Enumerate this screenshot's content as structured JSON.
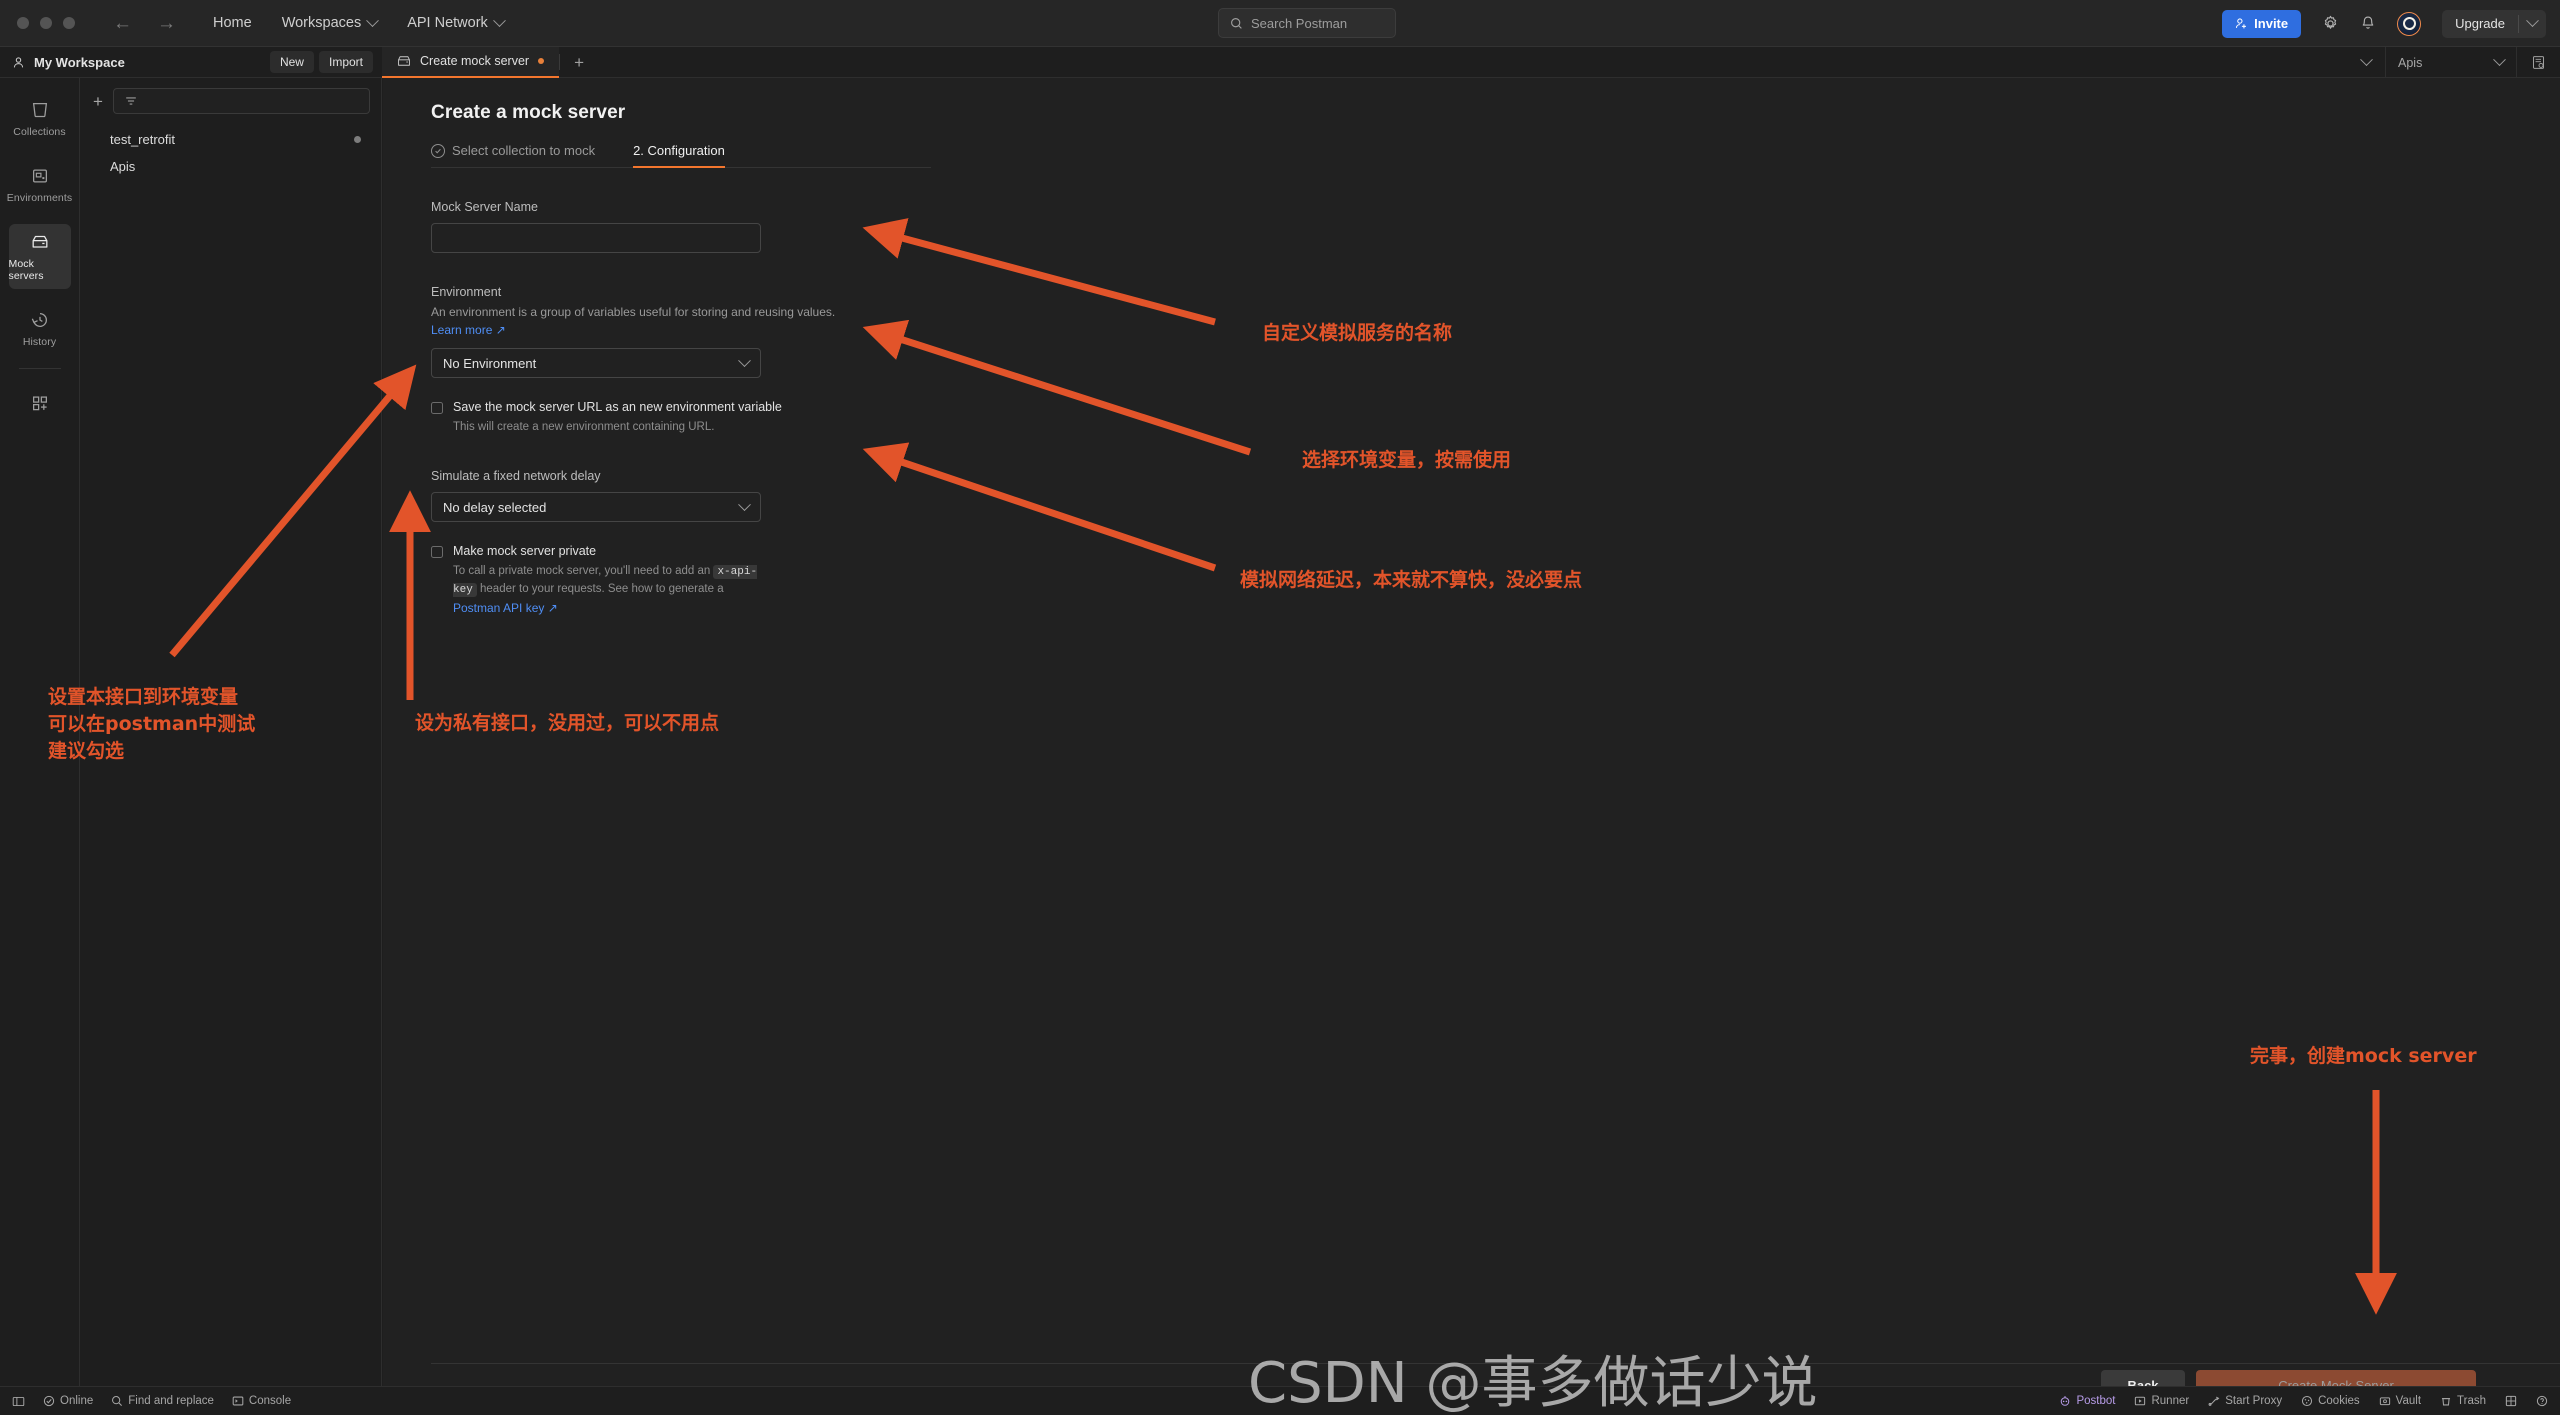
{
  "window": {
    "traffic_lights": [
      "close",
      "minimize",
      "maximize"
    ],
    "nav_back_icon": "arrow-left-icon",
    "nav_forward_icon": "arrow-right-icon"
  },
  "topnav": {
    "home": "Home",
    "workspaces": "Workspaces",
    "api_network": "API Network"
  },
  "search": {
    "placeholder": "Search Postman",
    "icon": "search-icon"
  },
  "topright": {
    "invite_label": "Invite",
    "invite_icon": "user-plus-icon",
    "settings_icon": "gear-icon",
    "notifications_icon": "bell-icon",
    "account_icon": "avatar-icon",
    "upgrade_label": "Upgrade",
    "upgrade_caret_icon": "chevron-down-icon",
    "accent_blue": "#2f6ee0"
  },
  "workspace": {
    "icon": "person-icon",
    "name": "My Workspace",
    "new_label": "New",
    "import_label": "Import"
  },
  "tabs": {
    "items": [
      {
        "icon": "mock-server-icon",
        "label": "Create mock server",
        "dirty": true,
        "active": true
      }
    ],
    "new_tab_icon": "plus-icon",
    "overflow_caret_icon": "chevron-down-icon",
    "environment_selected": "Apis",
    "environment_caret_icon": "chevron-down-icon",
    "env_quicklook_icon": "eye-document-icon",
    "active_underline_color": "#f3762e"
  },
  "rail": {
    "items": [
      {
        "icon": "collections-icon",
        "label": "Collections",
        "active": false
      },
      {
        "icon": "environments-icon",
        "label": "Environments",
        "active": false
      },
      {
        "icon": "mock-servers-icon",
        "label": "Mock servers",
        "active": true
      },
      {
        "icon": "history-icon",
        "label": "History",
        "active": false
      }
    ],
    "add_icon": "add-panel-icon"
  },
  "sidebar": {
    "add_icon": "plus-icon",
    "filter_icon": "filter-icon",
    "items": [
      {
        "label": "test_retrofit",
        "has_bullet": true
      },
      {
        "label": "Apis",
        "has_bullet": false
      }
    ]
  },
  "main": {
    "title": "Create a mock server",
    "steps": [
      {
        "label": "Select collection to mock",
        "icon": "check-circle-icon",
        "active": false
      },
      {
        "label": "2. Configuration",
        "icon": "",
        "active": true
      }
    ],
    "mock_server_name": {
      "label": "Mock Server Name",
      "value": "",
      "placeholder": ""
    },
    "environment": {
      "label": "Environment",
      "description": "An environment is a group of variables useful for storing and reusing values.",
      "learn_more": "Learn more",
      "learn_more_icon": "external-link-icon",
      "selected": "No Environment",
      "caret_icon": "chevron-down-icon"
    },
    "save_url_checkbox": {
      "checked": false,
      "label": "Save the mock server URL as an new environment variable",
      "sub": "This will create a new environment containing URL."
    },
    "network_delay": {
      "label": "Simulate a fixed network delay",
      "selected": "No delay selected",
      "caret_icon": "chevron-down-icon"
    },
    "private_checkbox": {
      "checked": false,
      "label": "Make mock server private",
      "sub_part1": "To call a private mock server, you'll need to add an ",
      "sub_code": "x-api-key",
      "sub_part2": " header to your requests. See how to generate a ",
      "sub_link": "Postman API key",
      "sub_link_icon": "external-link-icon"
    },
    "footer": {
      "back_label": "Back",
      "create_label": "Create Mock Server",
      "create_disabled": true,
      "create_color": "#8c4a32"
    }
  },
  "statusbar": {
    "left": [
      {
        "icon": "sidebar-toggle-icon",
        "label": ""
      },
      {
        "icon": "online-icon",
        "label": "Online"
      },
      {
        "icon": "search-icon",
        "label": "Find and replace"
      },
      {
        "icon": "console-icon",
        "label": "Console"
      }
    ],
    "right": [
      {
        "icon": "postbot-icon",
        "label": "Postbot",
        "accent": "#b79ce8"
      },
      {
        "icon": "runner-icon",
        "label": "Runner"
      },
      {
        "icon": "proxy-icon",
        "label": "Start Proxy"
      },
      {
        "icon": "cookies-icon",
        "label": "Cookies"
      },
      {
        "icon": "vault-icon",
        "label": "Vault"
      },
      {
        "icon": "trash-icon",
        "label": "Trash"
      },
      {
        "icon": "layout-icon",
        "label": ""
      },
      {
        "icon": "help-icon",
        "label": ""
      }
    ]
  },
  "annotations": {
    "color": "#e2542a",
    "notes": [
      {
        "id": "note-name",
        "text": "自定义模拟服务的名称"
      },
      {
        "id": "note-env",
        "text": "选择环境变量，按需使用"
      },
      {
        "id": "note-delay",
        "text": "模拟网络延迟，本来就不算快，没必要点"
      },
      {
        "id": "note-save",
        "text": "设置本接口到环境变量\n可以在postman中测试\n建议勾选"
      },
      {
        "id": "note-private",
        "text": "设为私有接口，没用过，可以不用点"
      },
      {
        "id": "note-create",
        "text": "完事，创建mock server"
      }
    ]
  },
  "watermark": {
    "text": "CSDN @事多做话少说"
  }
}
